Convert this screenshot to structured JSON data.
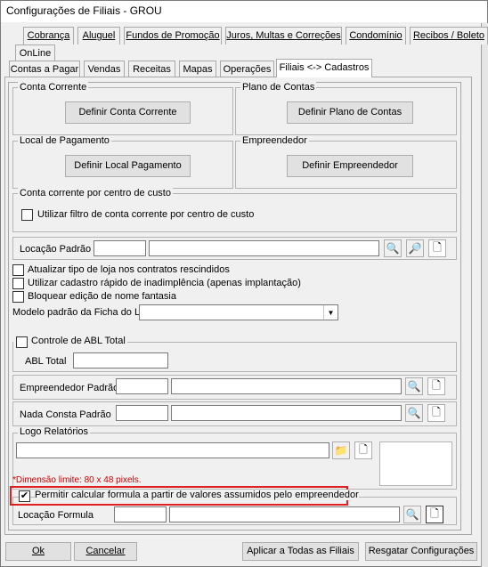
{
  "window": {
    "title": "Configurações de Filiais - GROU"
  },
  "tabs_row1": [
    "Cobrança",
    "Aluguel",
    "Fundos de Promoção",
    "Juros, Multas e Correções",
    "Condomínio",
    "Recibos / Boleto"
  ],
  "tabs_row2": [
    "OnLine"
  ],
  "tabs_row3": [
    "Contas a Pagar",
    "Vendas",
    "Receitas",
    "Mapas",
    "Operações",
    "Filiais <-> Cadastros"
  ],
  "groups": {
    "conta_corrente": {
      "title": "Conta Corrente",
      "button": "Definir Conta Corrente"
    },
    "plano_contas": {
      "title": "Plano de Contas",
      "button": "Definir Plano de Contas"
    },
    "local_pagamento": {
      "title": "Local de Pagamento",
      "button": "Definir Local Pagamento"
    },
    "empreendedor": {
      "title": "Empreendedor",
      "button": "Definir Empreendedor"
    },
    "cc_centro_custo": {
      "title": "Conta corrente por centro de custo",
      "checkbox_label": "Utilizar filtro de conta corrente por centro de custo",
      "checked": false
    }
  },
  "locacao_padrao": {
    "label": "Locação Padrão",
    "code": "",
    "name": ""
  },
  "options": [
    {
      "label": "Atualizar tipo de loja nos contratos rescindidos",
      "checked": false
    },
    {
      "label": "Utilizar cadastro rápido de inadimplência (apenas implantação)",
      "checked": false
    },
    {
      "label": "Bloquear edição de nome fantasia",
      "checked": false
    }
  ],
  "modelo_ficha": {
    "label": "Modelo padrão da Ficha do Lojista",
    "value": ""
  },
  "abl": {
    "title": "Controle de ABL Total",
    "checked": false,
    "abl_total_label": "ABL Total",
    "abl_total_value": ""
  },
  "empreendedor_padrao": {
    "label": "Empreendedor Padrão",
    "code": "",
    "name": ""
  },
  "nada_consta": {
    "label": "Nada Consta Padrão",
    "code": "",
    "name": ""
  },
  "logo": {
    "title": "Logo Relatórios",
    "path": "",
    "hint": "*Dimensão limite: 80 x 48 pixels."
  },
  "formula": {
    "checkbox_label": "Permitir calcular formula a partir de valores assumidos pelo empreendedor",
    "checked": true,
    "locacao_label": "Locação Formula",
    "code": "",
    "name": ""
  },
  "footer": {
    "ok": "Ok",
    "cancelar": "Cancelar",
    "aplicar": "Aplicar a Todas as Filiais",
    "resgatar": "Resgatar Configurações"
  },
  "colors": {
    "highlight": "#e02020",
    "hint": "#d00000",
    "background": "#f0f0f0"
  }
}
